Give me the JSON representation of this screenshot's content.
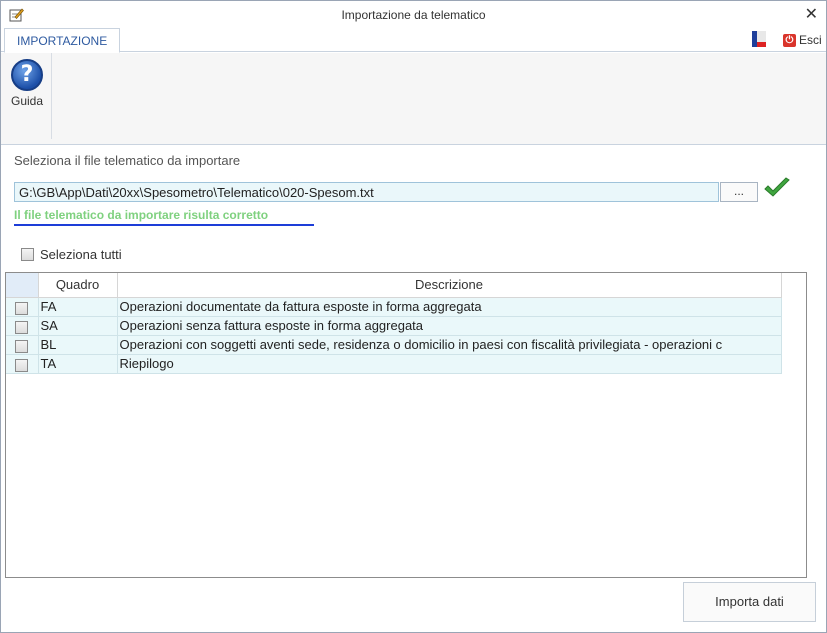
{
  "window": {
    "title": "Importazione da telematico"
  },
  "tabs": [
    {
      "label": "IMPORTAZIONE"
    }
  ],
  "header": {
    "exit_label": "Esci"
  },
  "ribbon": {
    "help_label": "Guida"
  },
  "main": {
    "select_label": "Seleziona il file telematico da importare",
    "file_path": "G:\\GB\\App\\Dati\\20xx\\Spesometro\\Telematico\\020-Spesom.txt",
    "browse_label": "...",
    "status_message": "Il file telematico da importare risulta corretto",
    "select_all_label": "Seleziona tutti",
    "import_button": "Importa dati"
  },
  "table": {
    "columns": [
      "Quadro",
      "Descrizione"
    ],
    "rows": [
      {
        "quadro": "FA",
        "descrizione": "Operazioni documentate da fattura esposte in forma aggregata"
      },
      {
        "quadro": "SA",
        "descrizione": "Operazioni senza fattura esposte in forma aggregata"
      },
      {
        "quadro": "BL",
        "descrizione": "Operazioni con soggetti aventi sede, residenza o domicilio in paesi con fiscalità privilegiata - operazioni c"
      },
      {
        "quadro": "TA",
        "descrizione": "Riepilogo"
      }
    ]
  },
  "colors": {
    "accent": "#2e5aa0",
    "success": "#7fd17f",
    "row_bg": "#eaf8fa"
  }
}
